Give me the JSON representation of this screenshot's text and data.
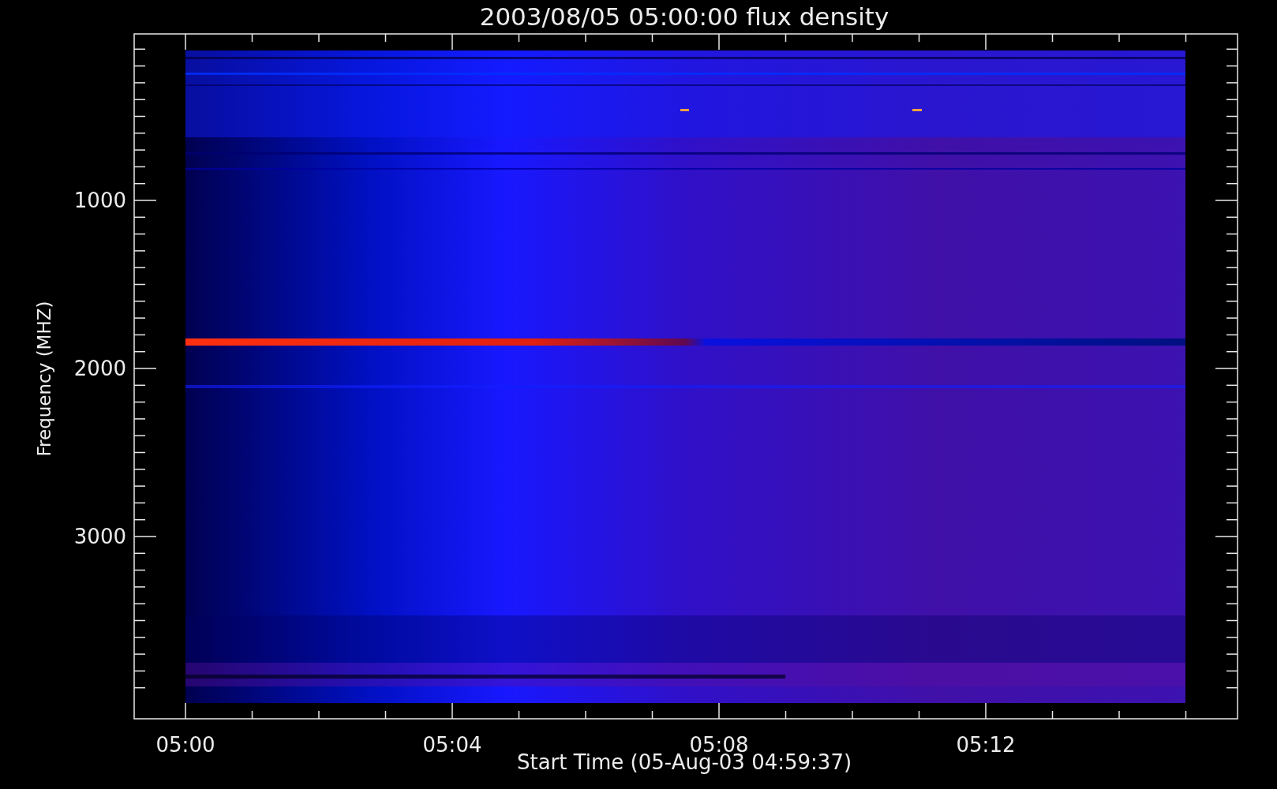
{
  "title": "2003/08/05 05:00:00 flux density",
  "xlabel": "Start Time (05-Aug-03 04:59:37)",
  "ylabel": "Frequency (MHZ)",
  "xticks": [
    "05:00",
    "05:04",
    "05:08",
    "05:12"
  ],
  "yticks": [
    "1000",
    "2000",
    "3000"
  ]
}
